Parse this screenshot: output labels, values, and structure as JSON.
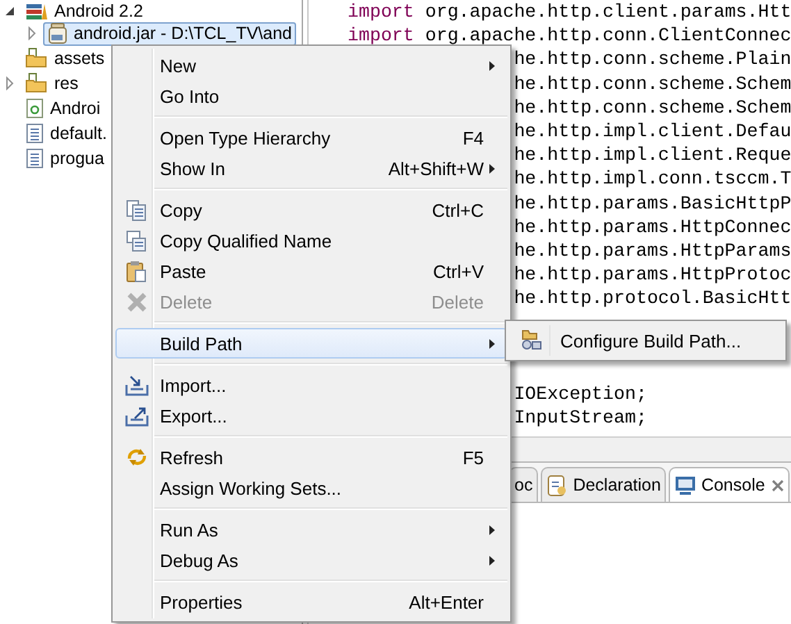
{
  "tree": [
    {
      "label": "Android 2.2",
      "kind": "library",
      "expanded": true,
      "selected": false,
      "children": [
        {
          "label": "android.jar - D:\\TCL_TV\\and",
          "kind": "jar",
          "expanded": false,
          "selected": true
        }
      ]
    },
    {
      "label": "assets",
      "kind": "folder",
      "selected": false
    },
    {
      "label": "res",
      "kind": "folder",
      "expanded": false,
      "selected": false
    },
    {
      "label": "Androi",
      "kind": "manifest",
      "selected": false
    },
    {
      "label": "default.",
      "kind": "file",
      "selected": false
    },
    {
      "label": "progua",
      "kind": "file",
      "selected": false
    }
  ],
  "code": {
    "blocks": [
      {
        "lines": [
          {
            "kind": "full",
            "keyword": "import",
            "text": " org.apache.http.client.params.Htt"
          },
          {
            "kind": "full",
            "keyword": "import",
            "text": " org.apache.http.conn.ClientConnec"
          },
          {
            "kind": "clipped",
            "text": "he.http.conn.scheme.Plain"
          },
          {
            "kind": "clipped",
            "text": "he.http.conn.scheme.Schem"
          },
          {
            "kind": "clipped",
            "text": "he.http.conn.scheme.Schem"
          },
          {
            "kind": "clipped",
            "text": "he.http.impl.client.Defau"
          },
          {
            "kind": "clipped",
            "text": "he.http.impl.client.Reque"
          },
          {
            "kind": "clipped",
            "text": "he.http.impl.conn.tsccm.T"
          },
          {
            "kind": "clipped",
            "text": "he.http.params.BasicHttpP"
          },
          {
            "kind": "clipped",
            "text": "he.http.params.HttpConnec"
          },
          {
            "kind": "clipped",
            "text": "he.http.params.HttpParams"
          },
          {
            "kind": "clipped",
            "text": "he.http.params.HttpProtoc"
          },
          {
            "kind": "clipped",
            "text": "he.http.protocol.BasicHtt"
          }
        ]
      },
      {
        "lines": [
          {
            "kind": "clipped",
            "text": "IOException;"
          },
          {
            "kind": "clipped",
            "text": "InputStream;"
          }
        ]
      }
    ]
  },
  "bottom_tabs": [
    {
      "label": "oc",
      "kind": "plain",
      "selected": false,
      "closable": false
    },
    {
      "label": "Declaration",
      "kind": "declaration",
      "selected": false,
      "closable": false
    },
    {
      "label": "Console",
      "kind": "console",
      "selected": true,
      "closable": true
    }
  ],
  "context_menu": {
    "groups": [
      [
        {
          "label": "New",
          "kind": "none",
          "submenu": true,
          "disabled": false,
          "selected": false
        },
        {
          "label": "Go Into",
          "kind": "none",
          "submenu": false,
          "disabled": false,
          "selected": false
        }
      ],
      [
        {
          "label": "Open Type Hierarchy",
          "shortcut": "F4",
          "kind": "none",
          "submenu": false,
          "disabled": false,
          "selected": false
        },
        {
          "label": "Show In",
          "shortcut": "Alt+Shift+W",
          "kind": "none",
          "submenu": true,
          "disabled": false,
          "selected": false
        }
      ],
      [
        {
          "label": "Copy",
          "shortcut": "Ctrl+C",
          "kind": "copy",
          "submenu": false,
          "disabled": false,
          "selected": false
        },
        {
          "label": "Copy Qualified Name",
          "kind": "copy-name",
          "submenu": false,
          "disabled": false,
          "selected": false
        },
        {
          "label": "Paste",
          "shortcut": "Ctrl+V",
          "kind": "paste",
          "submenu": false,
          "disabled": false,
          "selected": false
        },
        {
          "label": "Delete",
          "shortcut": "Delete",
          "kind": "delete",
          "submenu": false,
          "disabled": true,
          "selected": false
        }
      ],
      [
        {
          "label": "Build Path",
          "kind": "none",
          "submenu": true,
          "disabled": false,
          "selected": true
        }
      ],
      [
        {
          "label": "Import...",
          "kind": "import",
          "submenu": false,
          "disabled": false,
          "selected": false
        },
        {
          "label": "Export...",
          "kind": "export",
          "submenu": false,
          "disabled": false,
          "selected": false
        }
      ],
      [
        {
          "label": "Refresh",
          "shortcut": "F5",
          "kind": "refresh",
          "submenu": false,
          "disabled": false,
          "selected": false
        },
        {
          "label": "Assign Working Sets...",
          "kind": "none",
          "submenu": false,
          "disabled": false,
          "selected": false
        }
      ],
      [
        {
          "label": "Run As",
          "kind": "none",
          "submenu": true,
          "disabled": false,
          "selected": false
        },
        {
          "label": "Debug As",
          "kind": "none",
          "submenu": true,
          "disabled": false,
          "selected": false
        }
      ],
      [
        {
          "label": "Properties",
          "shortcut": "Alt+Enter",
          "kind": "none",
          "submenu": false,
          "disabled": false,
          "selected": false
        }
      ]
    ]
  },
  "submenu": {
    "items": [
      {
        "label": "Configure Build Path...",
        "kind": "build-path",
        "selected": false
      }
    ]
  }
}
